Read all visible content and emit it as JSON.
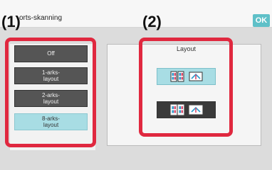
{
  "header": {
    "title": "orts-skanning",
    "ok_label": "OK"
  },
  "annotations": {
    "left_label": "(1)",
    "right_label": "(2)"
  },
  "left_options": [
    {
      "label": "Off",
      "selected": false
    },
    {
      "label": "1-arks-\nlayout",
      "selected": false
    },
    {
      "label": "2-arks-\nlayout",
      "selected": false
    },
    {
      "label": "8-arks-\nlayout",
      "selected": true
    }
  ],
  "layout_panel": {
    "title": "Layout",
    "options": [
      {
        "name": "layout-option-1",
        "selected": true
      },
      {
        "name": "layout-option-2",
        "selected": false
      }
    ]
  },
  "colors": {
    "selected": "#a8dde4",
    "accent": "#5fc0c8",
    "annotation_red": "#e0283f"
  }
}
